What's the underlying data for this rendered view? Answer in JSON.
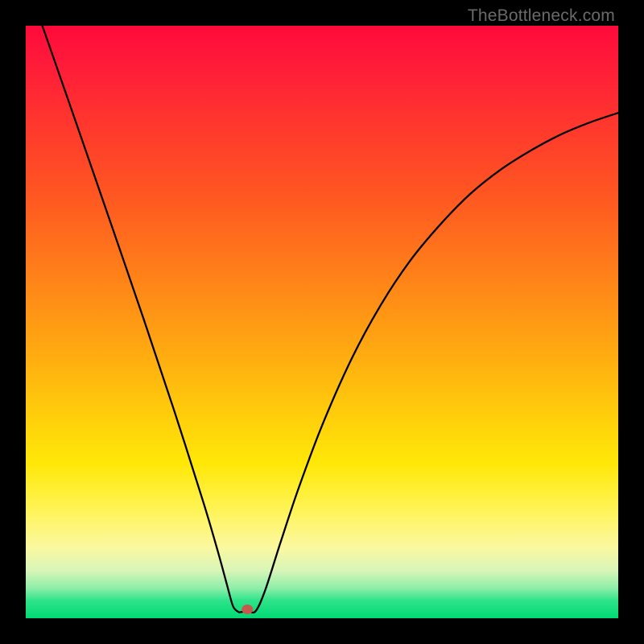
{
  "watermark": "TheBottleneck.com",
  "chart_data": {
    "type": "line",
    "title": "",
    "xlabel": "",
    "ylabel": "",
    "xlim": [
      0,
      1
    ],
    "ylim": [
      0,
      1
    ],
    "x": [
      0.028,
      0.05,
      0.1,
      0.15,
      0.2,
      0.25,
      0.3,
      0.325,
      0.34,
      0.35,
      0.36,
      0.375,
      0.388,
      0.404,
      0.43,
      0.46,
      0.5,
      0.55,
      0.6,
      0.65,
      0.7,
      0.75,
      0.8,
      0.85,
      0.9,
      0.95,
      1.0
    ],
    "y": [
      1.0,
      0.937,
      0.793,
      0.648,
      0.502,
      0.352,
      0.195,
      0.11,
      0.055,
      0.02,
      0.01,
      0.012,
      0.012,
      0.047,
      0.128,
      0.218,
      0.325,
      0.438,
      0.53,
      0.605,
      0.665,
      0.716,
      0.756,
      0.788,
      0.815,
      0.836,
      0.853
    ],
    "marker": {
      "x": 0.374,
      "y": 0.015,
      "color": "#c65a4a",
      "size": 6
    },
    "background_gradient": [
      "#ff0a3a",
      "#ff5522",
      "#ffa012",
      "#ffe808",
      "#fbf8a0",
      "#2ee38a",
      "#00da74"
    ]
  }
}
